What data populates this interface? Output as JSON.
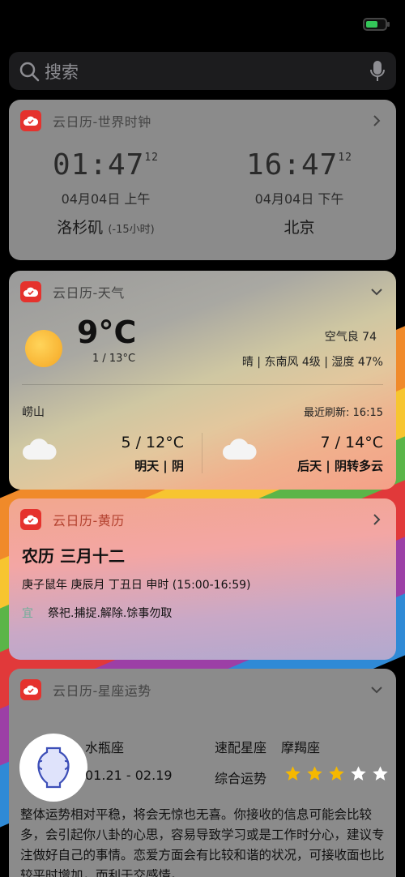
{
  "search": {
    "placeholder": "搜索"
  },
  "clock": {
    "title": "云日历-世界时钟",
    "cities": [
      {
        "time": "01:47",
        "seconds": "12",
        "date": "04月04日 上午",
        "city": "洛杉矶",
        "offset": "(-15小时)"
      },
      {
        "time": "16:47",
        "seconds": "12",
        "date": "04月04日 下午",
        "city": "北京",
        "offset": ""
      }
    ]
  },
  "weather": {
    "title": "云日历-天气",
    "temp": "9°C",
    "range": "1 / 13°C",
    "aqi": "空气良 74",
    "conditions": "晴 | 东南风  4级 | 湿度 47%",
    "location": "崂山",
    "refresh": "最近刷新: 16:15",
    "forecast": [
      {
        "temp": "5 / 12°C",
        "desc": "明天 | 阴",
        "icon": "cloud-icon"
      },
      {
        "temp": "7 / 14°C",
        "desc": "后天 | 阴转多云",
        "icon": "cloud-icon"
      }
    ]
  },
  "almanac": {
    "title": "云日历-黄历",
    "lunar_date": "农历 三月十二",
    "ganzhi": "庚子鼠年 庚辰月 丁丑日 申时 (15:00-16:59)",
    "yi_label": "宜",
    "yi_text": "祭祀.捕捉.解除.馀事勿取"
  },
  "horoscope": {
    "title": "云日历-星座运势",
    "sign": "水瓶座",
    "dates": "01.21 - 02.19",
    "match_label": "速配星座",
    "match_value": "摩羯座",
    "luck_label": "综合运势",
    "stars_total": 5,
    "stars_filled": 3,
    "text": "整体运势相对平稳，将会无惊也无喜。你接收的信息可能会比较多，会引起你八卦的心思，容易导致学习或是工作时分心，建议专注做好自己的事情。恋爱方面会有比较和谐的状况，可接收面也比较平时增加，而利于交感情。"
  },
  "colors": {
    "app_icon": "#e5322d",
    "star_filled": "#f5b800",
    "star_empty": "#ffffff",
    "battery": "#34c759"
  }
}
